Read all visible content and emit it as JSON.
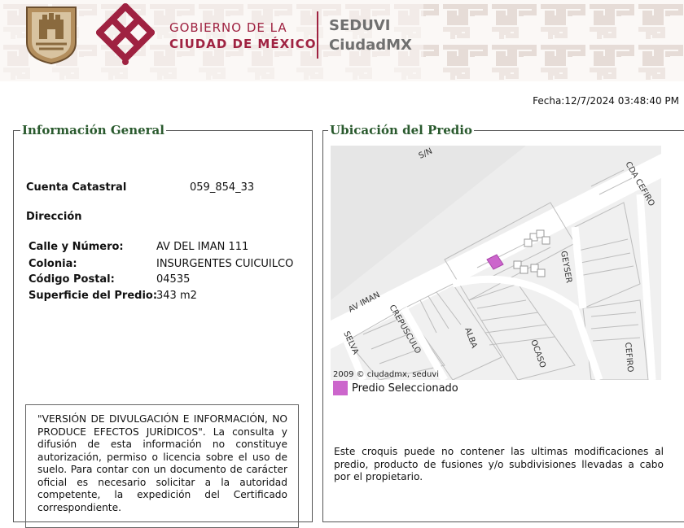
{
  "header": {
    "gov_line1": "GOBIERNO DE LA",
    "gov_line2": "CIUDAD DE MÉXICO",
    "org_line1": "SEDUVI",
    "org_line2": "CiudadMX"
  },
  "fecha": "Fecha:12/7/2024 03:48:40 PM",
  "info_general": {
    "title": "Información General",
    "cuenta_label": "Cuenta Catastral",
    "cuenta_value": "059_854_33",
    "direccion_label": "Dirección",
    "calle_label": "Calle y Número:",
    "calle_value": "AV DEL IMAN 111",
    "colonia_label": "Colonia:",
    "colonia_value": "INSURGENTES CUICUILCO",
    "cp_label": "Código Postal:",
    "cp_value": "04535",
    "superficie_label": "Superficie del Predio:",
    "superficie_value": "343 m2",
    "notice": "\"VERSIÓN DE DIVULGACIÓN E INFORMACIÓN, NO PRODUCE EFECTOS JURÍDICOS\". La consulta y difusión de esta información no constituye autorización, permiso o licencia sobre el uso de suelo. Para contar con un documento de carácter oficial es necesario solicitar a la autoridad competente, la expedición del Certificado correspondiente."
  },
  "ubicacion": {
    "title": "Ubicación del Predio",
    "map_labels": {
      "sn": "S/N",
      "cda_cefiro": "CDA CEFIRO",
      "av_iman": "AV IMAN",
      "geyser": "GEYSER",
      "crepusculo": "CREPUSCULO",
      "alba": "ALBA",
      "ocaso": "OCASO",
      "selva": "SELVA",
      "cefiro": "CEFIRO",
      "credit": "2009 © ciudadmx, seduvi"
    },
    "legend_label": "Predio Seleccionado",
    "legend_color": "#cc66cc",
    "note": "Este croquis puede no contener las ultimas modificaciones al predio, producto de fusiones y/o subdivisiones llevadas a cabo por el propietario."
  },
  "colors": {
    "accent": "#9f2241",
    "legend_title": "#2a5a2e"
  }
}
